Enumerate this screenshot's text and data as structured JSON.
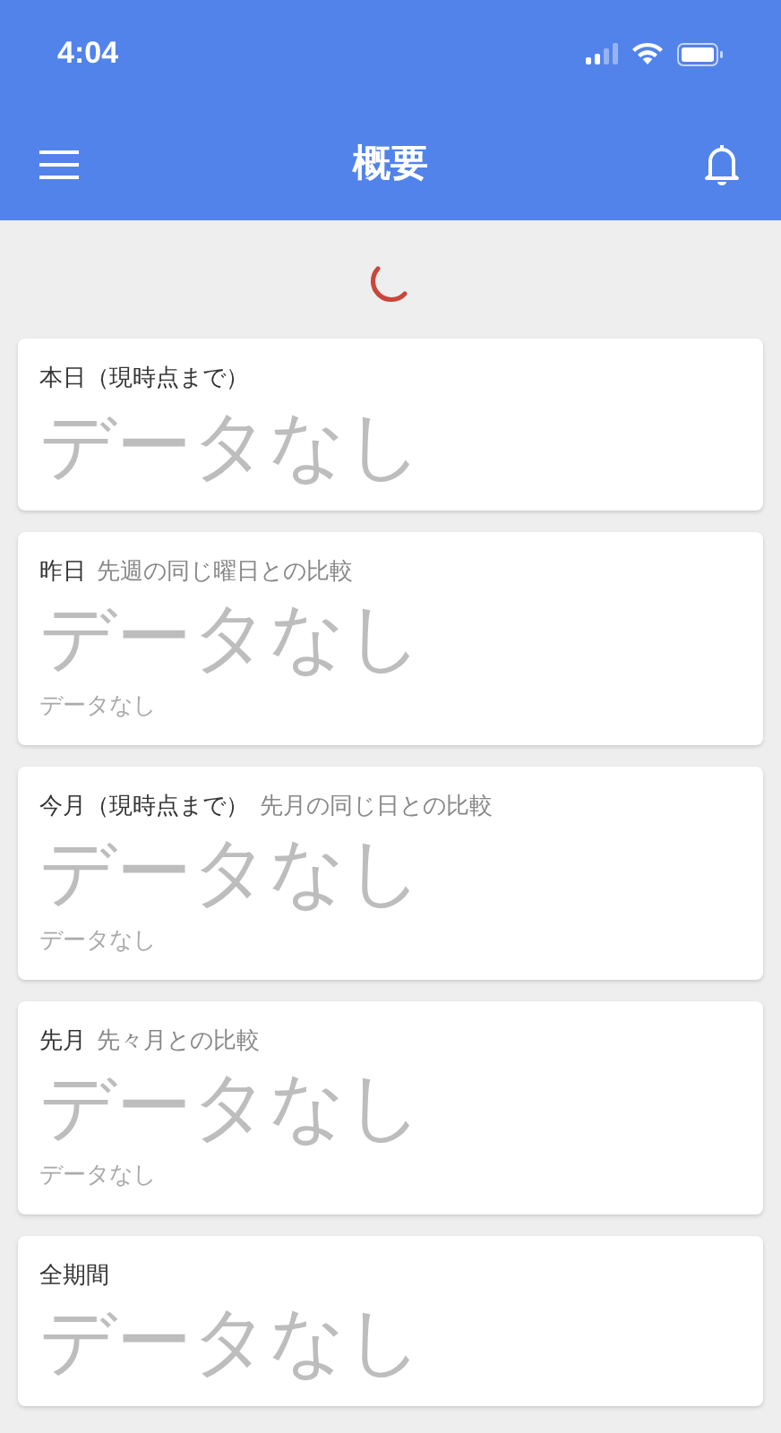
{
  "status_bar": {
    "time": "4:04"
  },
  "header": {
    "title": "概要"
  },
  "cards": [
    {
      "title": "本日（現時点まで）",
      "value": "データなし"
    },
    {
      "title": "昨日",
      "subtitle": "先週の同じ曜日との比較",
      "value": "データなし",
      "comparison": "データなし"
    },
    {
      "title": "今月（現時点まで）",
      "subtitle": "先月の同じ日との比較",
      "value": "データなし",
      "comparison": "データなし"
    },
    {
      "title": "先月",
      "subtitle": "先々月との比較",
      "value": "データなし",
      "comparison": "データなし"
    },
    {
      "title": "全期間",
      "value": "データなし"
    }
  ]
}
